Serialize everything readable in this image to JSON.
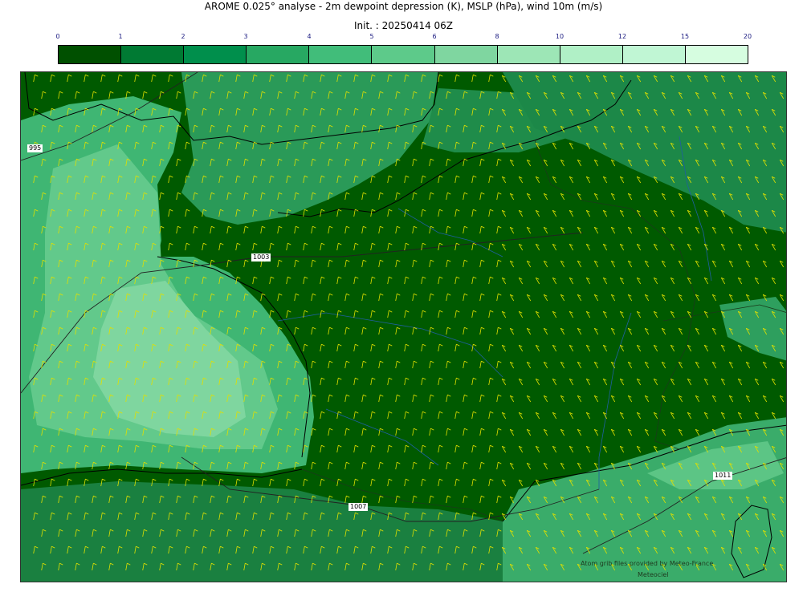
{
  "title_line1": "AROME 0.025° analyse - 2m dewpoint depression (K), MSLP (hPa), wind 10m (m/s)",
  "title_line2": "Init. : 20250414 06Z",
  "colorbar": {
    "ticks": [
      "0",
      "1",
      "2",
      "3",
      "4",
      "5",
      "6",
      "8",
      "10",
      "12",
      "15",
      "20"
    ],
    "colors": [
      "#005000",
      "#007a33",
      "#008f4c",
      "#27a862",
      "#41bd7a",
      "#5dca8a",
      "#7fd6a0",
      "#9de6b6",
      "#b0f0c6",
      "#c0f6d4",
      "#d6fde0"
    ]
  },
  "map": {
    "land_color": "#005a00",
    "sea_color": "#3a9e62",
    "wind_barb_color": "#e0e000",
    "isobar_labels": [
      "995",
      "1003",
      "1007",
      "1011"
    ]
  },
  "credits": {
    "line1": "Atom grib files provided by Meteo-France",
    "line2": "Meteociel"
  }
}
